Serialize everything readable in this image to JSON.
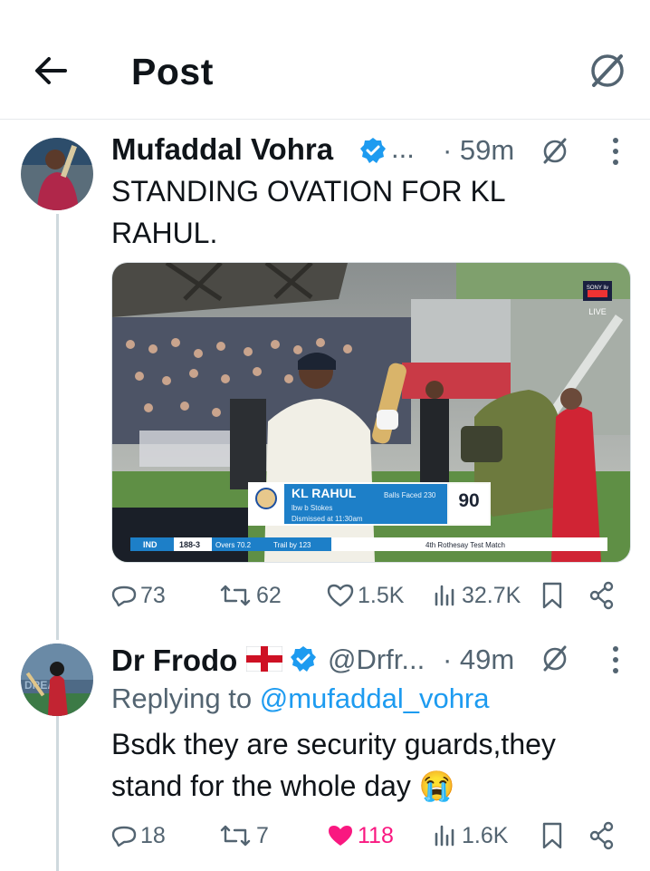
{
  "header": {
    "title": "Post"
  },
  "posts": [
    {
      "author": "Mufaddal Vohra",
      "handle": "...",
      "time": "· 59m",
      "text": "STANDING OVATION FOR KL RAHUL.",
      "media": {
        "broadcaster": "SONY liv",
        "live_label": "LIVE",
        "player": "KL RAHUL",
        "dismissal": "lbw b Stokes",
        "dismissed_at": "Dismissed at 11:30am",
        "balls_label": "Balls Faced 230",
        "runs": "90",
        "team": "IND",
        "score": "188-3",
        "overs": "Overs 70.2",
        "trail": "Trail by 123",
        "match": "4th Rothesay Test Match"
      },
      "stats": {
        "replies": "73",
        "reposts": "62",
        "likes": "1.5K",
        "views": "32.7K"
      }
    },
    {
      "author": "Dr Frodo",
      "handle": "@Drfr...",
      "time": "· 49m",
      "replying_prefix": "Replying to ",
      "replying_handle": "@mufaddal_vohra",
      "text": "Bsdk they are security guards,they stand for the whole day",
      "emoji": "😭",
      "stats": {
        "replies": "18",
        "reposts": "7",
        "likes": "118",
        "views": "1.6K"
      }
    }
  ],
  "colors": {
    "accent": "#1d9bf0",
    "like": "#f91880",
    "muted": "#536471"
  }
}
